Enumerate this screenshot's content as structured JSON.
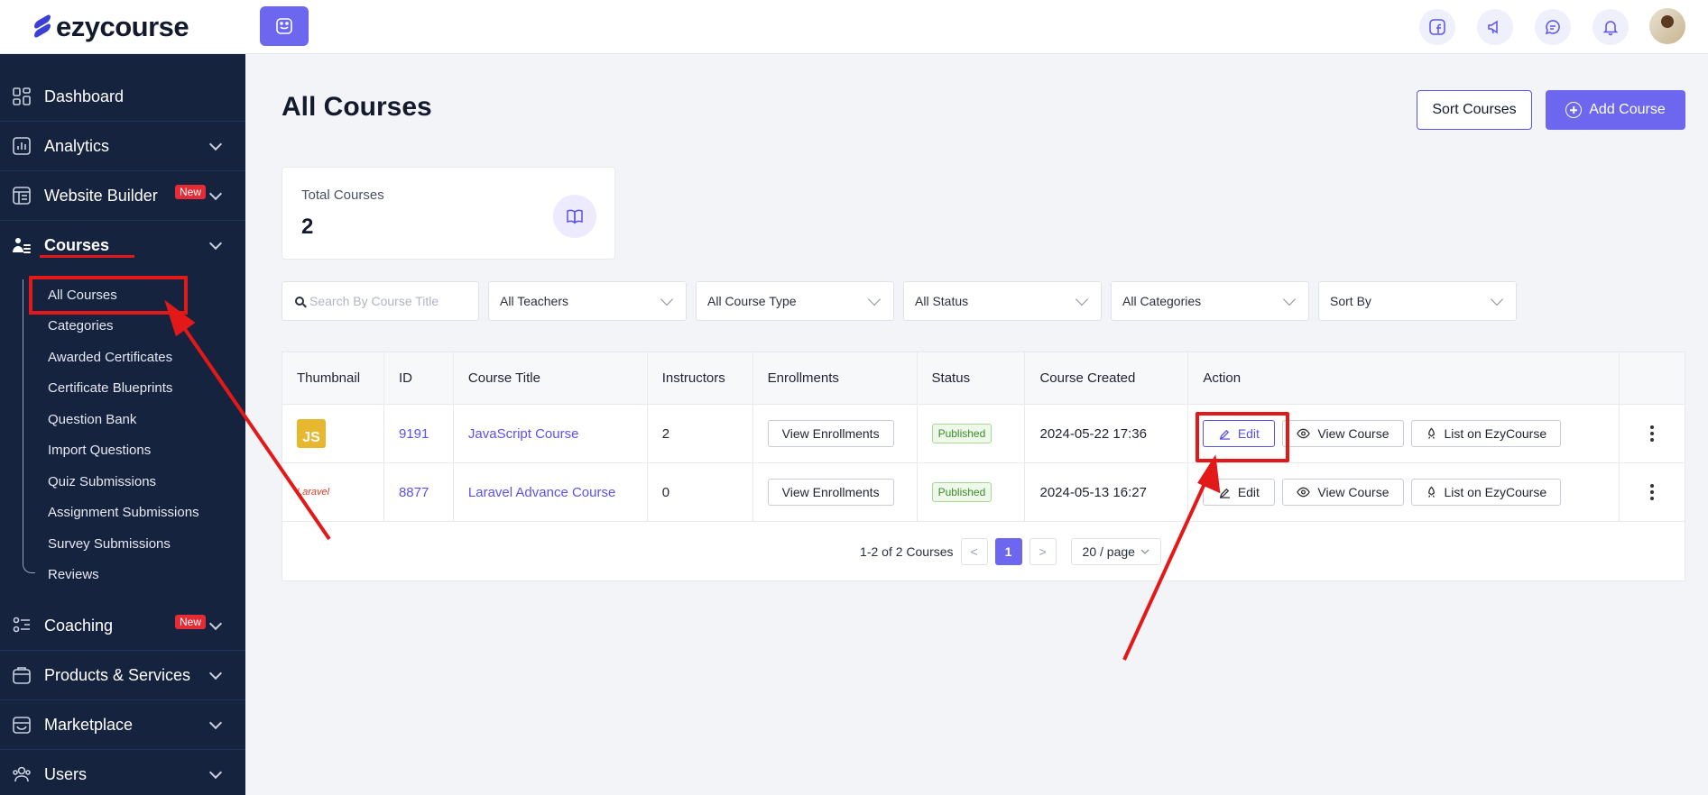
{
  "app": {
    "logo_text": "ezycourse"
  },
  "sidebar": {
    "items_top": [
      {
        "label": "Dashboard",
        "icon": "dashboard-icon",
        "has_chevron": false,
        "badge": ""
      },
      {
        "label": "Analytics",
        "icon": "analytics-icon",
        "has_chevron": true,
        "badge": ""
      },
      {
        "label": "Website Builder",
        "icon": "website-builder-icon",
        "has_chevron": true,
        "badge": "New"
      },
      {
        "label": "Courses",
        "icon": "courses-icon",
        "has_chevron": true,
        "badge": ""
      }
    ],
    "course_subitems": [
      "All Courses",
      "Categories",
      "Awarded Certificates",
      "Certificate Blueprints",
      "Question Bank",
      "Import Questions",
      "Quiz Submissions",
      "Assignment Submissions",
      "Survey Submissions",
      "Reviews"
    ],
    "items_bottom": [
      {
        "label": "Coaching",
        "icon": "coaching-icon",
        "badge": "New"
      },
      {
        "label": "Products & Services",
        "icon": "products-icon",
        "badge": ""
      },
      {
        "label": "Marketplace",
        "icon": "marketplace-icon",
        "badge": ""
      },
      {
        "label": "Users",
        "icon": "users-icon",
        "badge": ""
      }
    ]
  },
  "topbar": {
    "icons": [
      "facebook-icon",
      "megaphone-icon",
      "chat-icon",
      "bell-icon"
    ]
  },
  "page": {
    "title": "All Courses",
    "sort_button": "Sort Courses",
    "add_button": "Add Course"
  },
  "stats": {
    "label": "Total Courses",
    "value": "2"
  },
  "filters": {
    "search_placeholder": "Search By Course Title",
    "teachers": "All Teachers",
    "course_type": "All Course Type",
    "status": "All Status",
    "categories": "All Categories",
    "sort": "Sort By"
  },
  "table": {
    "headers": [
      "Thumbnail",
      "ID",
      "Course Title",
      "Instructors",
      "Enrollments",
      "Status",
      "Course Created",
      "Action"
    ],
    "rows": [
      {
        "thumb": "JS",
        "id": "9191",
        "title": "JavaScript Course",
        "instructors": "2",
        "enroll_btn": "View Enrollments",
        "status": "Published",
        "created": "2024-05-22 17:36",
        "edit": "Edit",
        "view": "View Course",
        "list": "List on EzyCourse"
      },
      {
        "thumb": "Laravel",
        "id": "8877",
        "title": "Laravel Advance Course",
        "instructors": "0",
        "enroll_btn": "View Enrollments",
        "status": "Published",
        "created": "2024-05-13 16:27",
        "edit": "Edit",
        "view": "View Course",
        "list": "List on EzyCourse"
      }
    ]
  },
  "pagination": {
    "summary": "1-2 of 2 Courses",
    "prev": "<",
    "current": "1",
    "next": ">",
    "per_page": "20 / page"
  }
}
